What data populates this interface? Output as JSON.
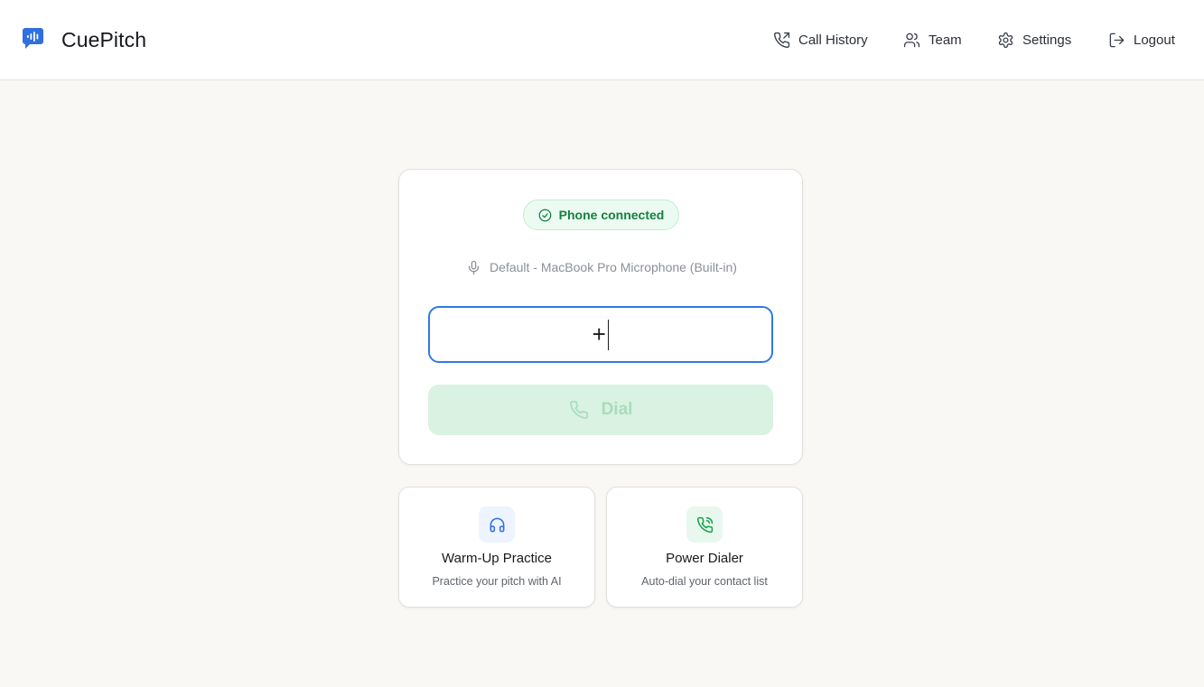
{
  "header": {
    "brand": "CuePitch",
    "nav": [
      {
        "label": "Call History",
        "icon": "phone-outgoing-icon"
      },
      {
        "label": "Team",
        "icon": "users-icon"
      },
      {
        "label": "Settings",
        "icon": "gear-icon"
      },
      {
        "label": "Logout",
        "icon": "logout-icon"
      }
    ]
  },
  "dialer": {
    "status": "Phone connected",
    "microphone": "Default - MacBook Pro Microphone (Built-in)",
    "phone_value": "+",
    "dial_label": "Dial"
  },
  "features": [
    {
      "title": "Warm-Up Practice",
      "subtitle": "Practice your pitch with AI",
      "icon": "headphones-icon"
    },
    {
      "title": "Power Dialer",
      "subtitle": "Auto-dial your contact list",
      "icon": "phone-call-icon"
    }
  ],
  "colors": {
    "accent_blue": "#2f7ae5",
    "success_green": "#15803d",
    "dial_disabled_bg": "#d9f2e2",
    "background": "#f9f8f5"
  }
}
